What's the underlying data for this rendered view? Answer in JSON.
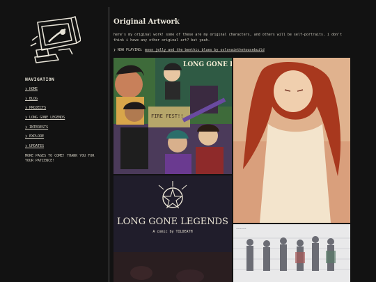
{
  "sidebar": {
    "logo_icon": "retro-computer-icon",
    "nav_title": "NAVIGATION",
    "nav_items": [
      {
        "label": "❯ HOME"
      },
      {
        "label": "❯ BLOG"
      },
      {
        "label": "❯ PROJECTS"
      },
      {
        "label": "❯ LONG GONE LEGENDS"
      },
      {
        "label": "❯ INTERESTS"
      },
      {
        "label": "❯ EXPLORE"
      },
      {
        "label": "❯ UPDATES"
      }
    ],
    "note": "MORE PAGES TO COME! THANK YOU FOR YOUR PATIENCE!"
  },
  "main": {
    "title": "Original Artwork",
    "intro": "here's my original work! some of these are my original characters, and others will be self-portraits. i don't think i have any other original art? but yeah.",
    "now_playing_label": "❯ NOW PLAYING:",
    "now_playing_track": "moon jelly and the benthic blues by oslovainthehousebuild",
    "gallery": [
      {
        "name": "long-gone-legends-group-art",
        "caption": "LONG GONE LEGENDS",
        "sign": "FIRE FEST!!"
      },
      {
        "name": "red-hair-portrait",
        "caption": "",
        "sign": ""
      },
      {
        "name": "long-gone-legends-cover",
        "caption": "LONG GONE LEGENDS",
        "subtitle": "A comic by TILDEATH"
      },
      {
        "name": "character-lineup-sketch",
        "caption": "",
        "sign": ""
      }
    ]
  },
  "colors": {
    "background": "#121212",
    "text": "#d8d4c8",
    "divider": "#5a5a5a"
  }
}
